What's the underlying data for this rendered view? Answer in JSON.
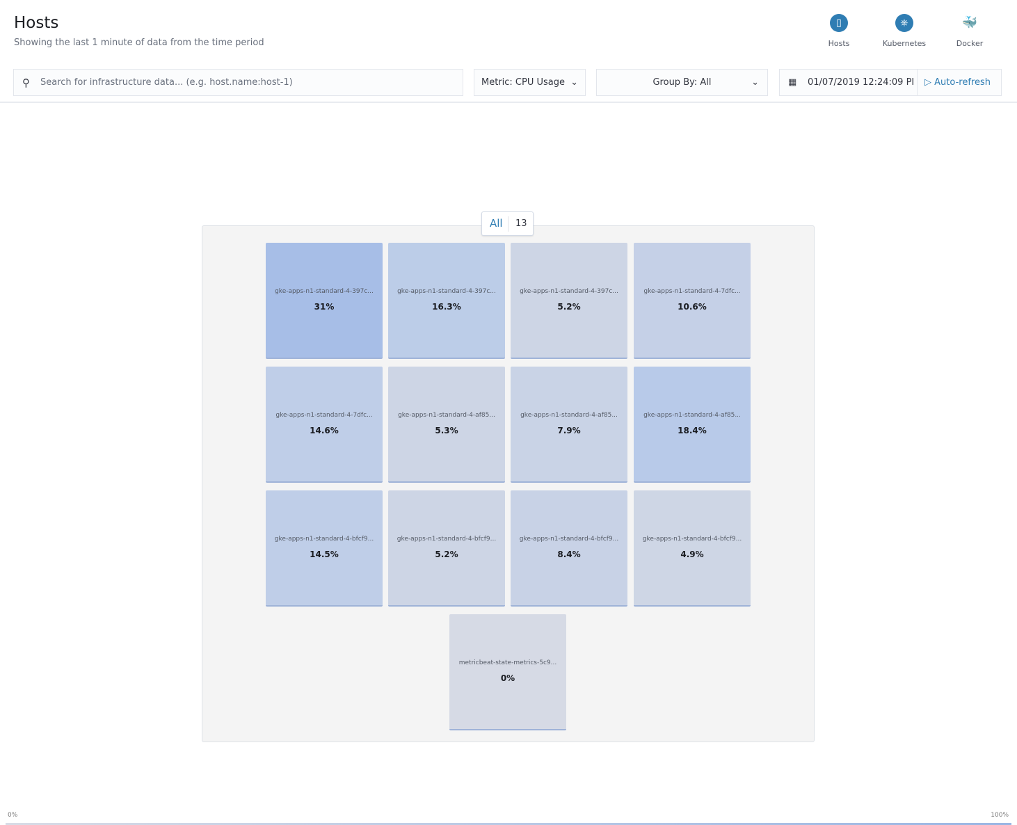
{
  "header": {
    "title": "Hosts",
    "subtitle": "Showing the last 1 minute of data from the time period"
  },
  "nav": [
    {
      "label": "Hosts",
      "icon": "host-icon"
    },
    {
      "label": "Kubernetes",
      "icon": "kubernetes-icon"
    },
    {
      "label": "Docker",
      "icon": "docker-icon"
    }
  ],
  "toolbar": {
    "search_placeholder": "Search for infrastructure data... (e.g. host.name:host-1)",
    "metric": "Metric: CPU Usage",
    "group_by": "Group By: All",
    "date": "01/07/2019 12:24:09 PI",
    "auto_refresh": "Auto-refresh"
  },
  "group": {
    "label": "All",
    "count": "13"
  },
  "tiles": [
    {
      "name": "gke-apps-n1-standard-4-397c...",
      "value": "31%",
      "color": "#a7bee7"
    },
    {
      "name": "gke-apps-n1-standard-4-397c...",
      "value": "16.3%",
      "color": "#bccde8"
    },
    {
      "name": "gke-apps-n1-standard-4-397c...",
      "value": "5.2%",
      "color": "#cdd5e5"
    },
    {
      "name": "gke-apps-n1-standard-4-7dfc...",
      "value": "10.6%",
      "color": "#c5d0e7"
    },
    {
      "name": "gke-apps-n1-standard-4-7dfc...",
      "value": "14.6%",
      "color": "#bfcee8"
    },
    {
      "name": "gke-apps-n1-standard-4-af85...",
      "value": "5.3%",
      "color": "#cdd5e5"
    },
    {
      "name": "gke-apps-n1-standard-4-af85...",
      "value": "7.9%",
      "color": "#c9d3e6"
    },
    {
      "name": "gke-apps-n1-standard-4-af85...",
      "value": "18.4%",
      "color": "#b8cae9"
    },
    {
      "name": "gke-apps-n1-standard-4-bfcf9...",
      "value": "14.5%",
      "color": "#bfcee8"
    },
    {
      "name": "gke-apps-n1-standard-4-bfcf9...",
      "value": "5.2%",
      "color": "#cdd5e5"
    },
    {
      "name": "gke-apps-n1-standard-4-bfcf9...",
      "value": "8.4%",
      "color": "#c8d2e6"
    },
    {
      "name": "gke-apps-n1-standard-4-bfcf9...",
      "value": "4.9%",
      "color": "#ced6e5"
    },
    {
      "name": "metricbeat-state-metrics-5c9...",
      "value": "0%",
      "color": "#d6dae5"
    }
  ],
  "legend": {
    "min": "0%",
    "max": "100%"
  }
}
